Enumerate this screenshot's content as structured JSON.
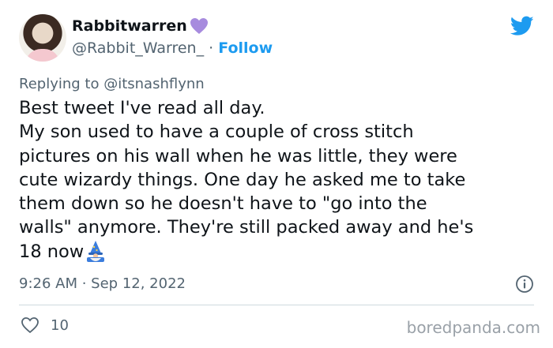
{
  "author": {
    "display_name": "Rabbitwarren",
    "handle": "@Rabbit_Warren_",
    "separator": " · ",
    "follow_label": "Follow",
    "badge_icon": "purple-heart-icon"
  },
  "reply": {
    "prefix": "Replying to ",
    "to": "@itsnashflynn"
  },
  "tweet": {
    "lines": [
      "Best tweet I've read all day.",
      "My son used to have a couple of cross stitch",
      "pictures on his wall when he was little, they were",
      "cute wizardy things. One day he asked me to take",
      "them down so he doesn't have to \"go into the",
      "walls\" anymore. They're still packed away and he's",
      "18 now"
    ],
    "trailing_emoji": "wizard-emoji"
  },
  "meta": {
    "time": "9:26 AM",
    "separator": " · ",
    "date": "Sep 12, 2022"
  },
  "actions": {
    "like_count": "10"
  },
  "watermark": "boredpanda.com",
  "colors": {
    "twitter_blue": "#1d9bf0",
    "text": "#0f1419",
    "muted": "#536471",
    "heart_purple": "#a78bde"
  }
}
